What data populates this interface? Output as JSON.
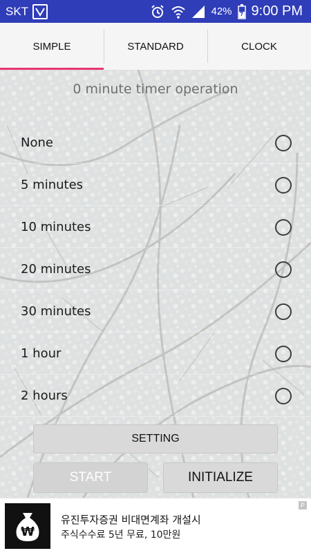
{
  "status_bar": {
    "carrier": "SKT",
    "battery_percent": "42%",
    "time": "9:00 PM",
    "icons": [
      "carrier-logo-icon",
      "alarm-icon",
      "wifi-icon",
      "signal-icon",
      "battery-icon"
    ]
  },
  "tabs": [
    {
      "label": "SIMPLE",
      "active": true
    },
    {
      "label": "STANDARD",
      "active": false
    },
    {
      "label": "CLOCK",
      "active": false
    }
  ],
  "timer_status": "0 minute timer operation",
  "options": [
    {
      "label": "None",
      "selected": false
    },
    {
      "label": "5 minutes",
      "selected": false
    },
    {
      "label": "10 minutes",
      "selected": false
    },
    {
      "label": "20 minutes",
      "selected": false
    },
    {
      "label": "30 minutes",
      "selected": false
    },
    {
      "label": "1 hour",
      "selected": false
    },
    {
      "label": "2 hours",
      "selected": false
    }
  ],
  "buttons": {
    "setting": "SETTING",
    "start": "START",
    "initialize": "INITIALIZE"
  },
  "ad": {
    "title": "유진투자증권 비대면계좌 개설시",
    "subtitle": "주식수수료 5년 무료, 10만원",
    "badge": "P"
  },
  "colors": {
    "status_bar": "#2f3db8",
    "tab_indicator": "#e8356f",
    "background": "#ececec"
  }
}
